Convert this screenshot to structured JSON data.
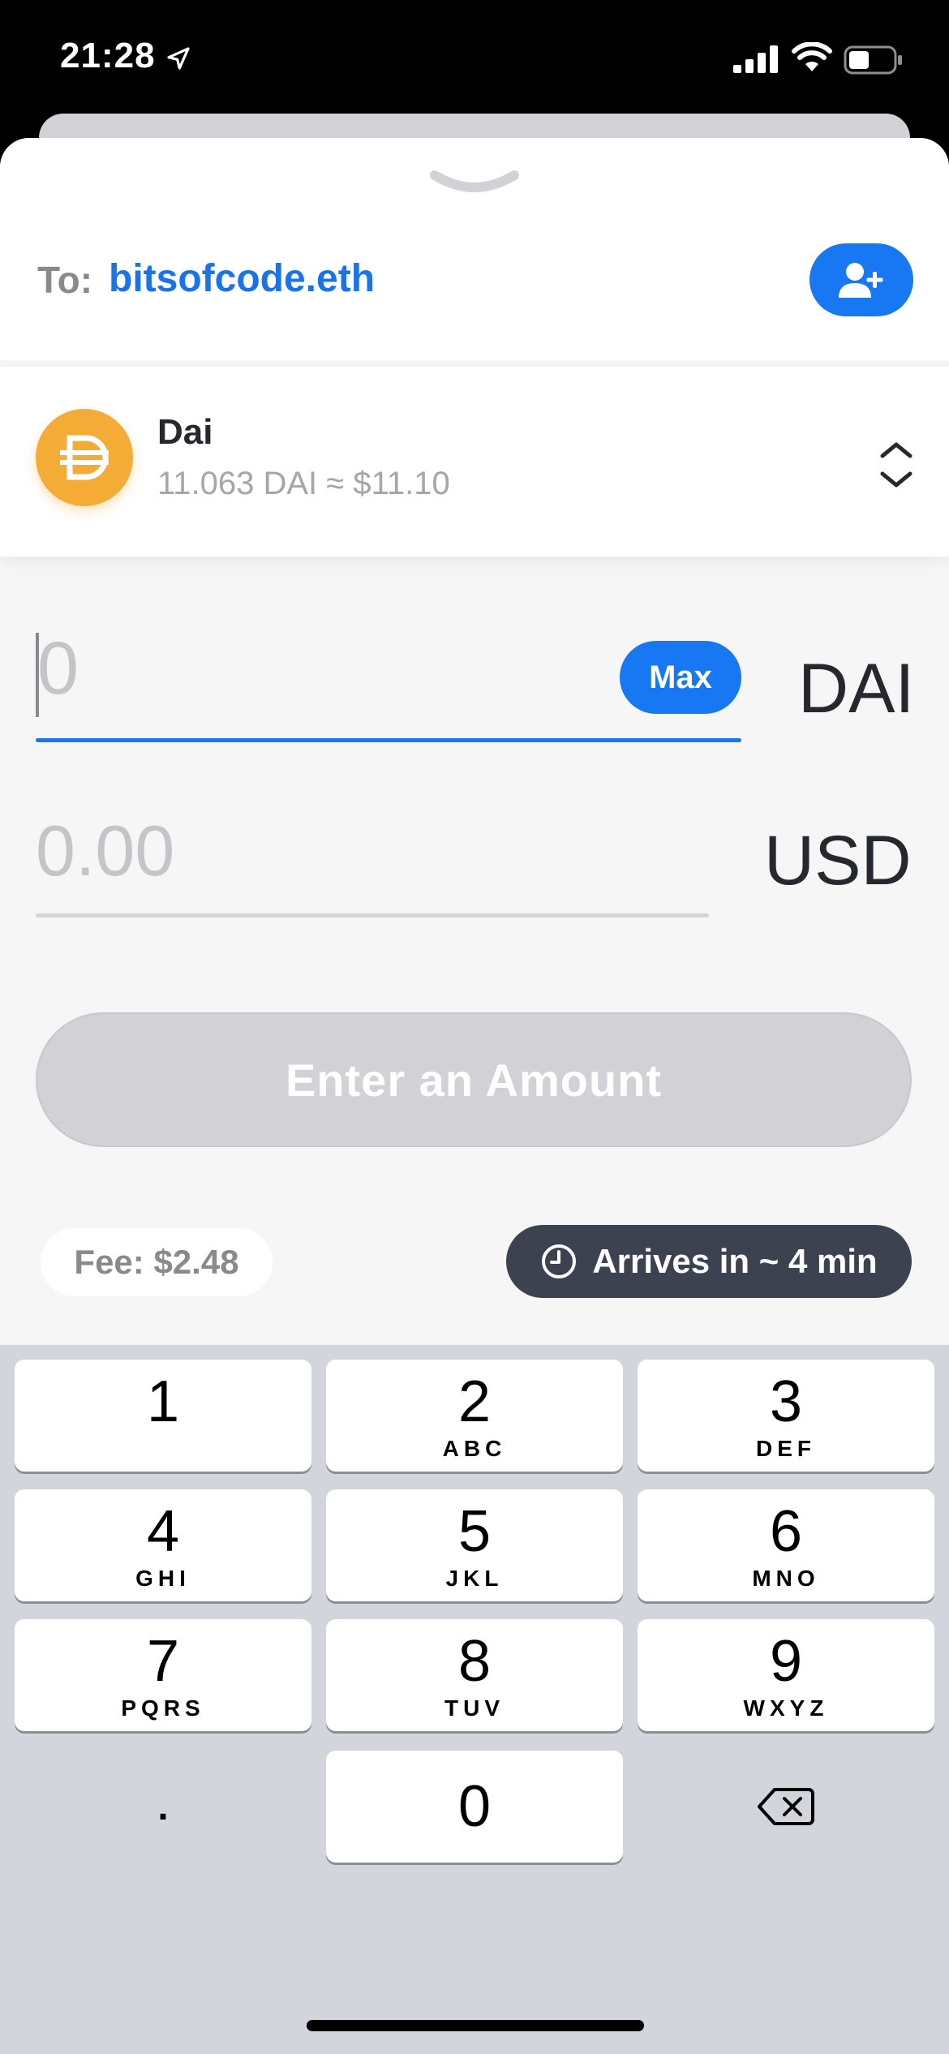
{
  "status_bar": {
    "time": "21:28",
    "icons": [
      "location-arrow-icon",
      "cellular-signal-icon",
      "wifi-icon",
      "battery-icon"
    ]
  },
  "recipient": {
    "label": "To:",
    "value": "bitsofcode.eth",
    "add_contact_icon": "add-contact-icon"
  },
  "token": {
    "name": "Dai",
    "balance": "11.063 DAI ≈ $11.10",
    "icon": "dai-icon"
  },
  "amount": {
    "placeholder": "0",
    "max_label": "Max",
    "unit": "DAI"
  },
  "fiat": {
    "value": "0.00",
    "unit": "USD"
  },
  "action": {
    "label": "Enter an Amount"
  },
  "fee": {
    "label": "Fee: $2.48"
  },
  "eta": {
    "label": "Arrives in ~ 4 min",
    "icon": "clock-icon"
  },
  "keyboard": {
    "keys": [
      {
        "digit": "1",
        "letters": ""
      },
      {
        "digit": "2",
        "letters": "ABC"
      },
      {
        "digit": "3",
        "letters": "DEF"
      },
      {
        "digit": "4",
        "letters": "GHI"
      },
      {
        "digit": "5",
        "letters": "JKL"
      },
      {
        "digit": "6",
        "letters": "MNO"
      },
      {
        "digit": "7",
        "letters": "PQRS"
      },
      {
        "digit": "8",
        "letters": "TUV"
      },
      {
        "digit": "9",
        "letters": "WXYZ"
      },
      {
        "digit": "0",
        "letters": ""
      }
    ],
    "decimal": ".",
    "delete_icon": "backspace-icon"
  },
  "colors": {
    "accent": "#1877f2",
    "link": "#1a73e8",
    "dai": "#f5ac37",
    "eta_bg": "#3c4250",
    "disabled_button": "#d1d1d6"
  }
}
